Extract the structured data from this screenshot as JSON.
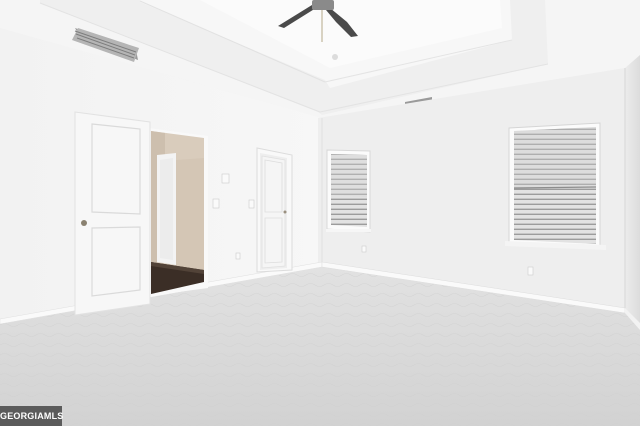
{
  "watermark": {
    "text": "GEORGIAMLS"
  },
  "colors": {
    "wall_left": "#f4f4f4",
    "wall_back": "#eeeeee",
    "wall_right": "#e9e9e9",
    "ceiling": "#f6f6f6",
    "carpet": "#dcdcdc",
    "door": "#f7f7f7",
    "hall_floor": "#3b2e26",
    "hall_wall": "#d8cbbb"
  }
}
